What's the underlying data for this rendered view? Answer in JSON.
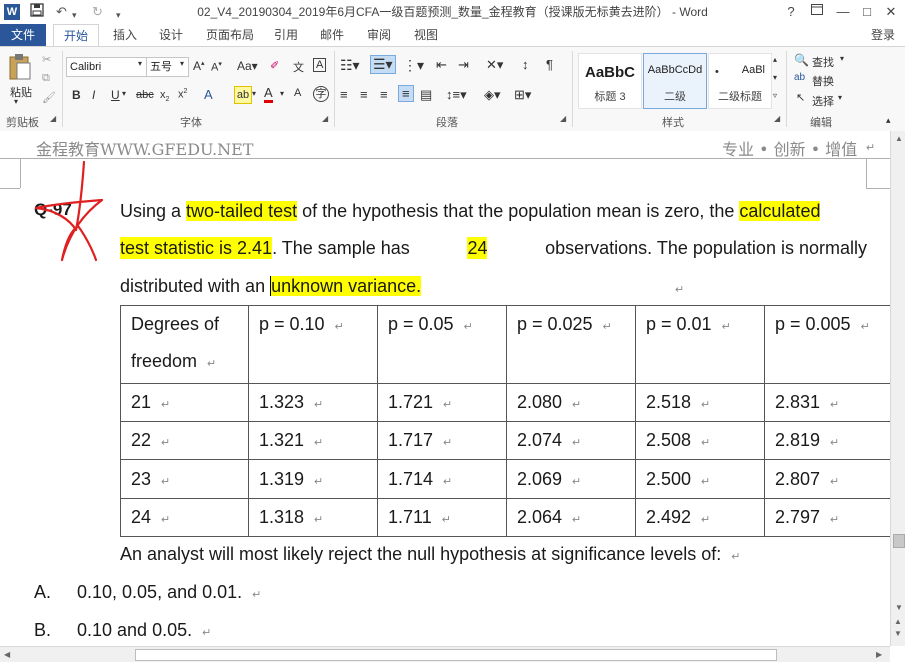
{
  "titlebar": {
    "app_icon": "W",
    "title": "02_V4_20190304_2019年6月CFA一级百题预测_数量_金程教育（授课版无标黄去进阶） - Word",
    "help": "?",
    "minimize": "—",
    "restore": "□",
    "close": "✕"
  },
  "tabs": {
    "file": "文件",
    "items": [
      "开始",
      "插入",
      "设计",
      "页面布局",
      "引用",
      "邮件",
      "审阅",
      "视图"
    ],
    "login": "登录"
  },
  "ribbon": {
    "clipboard": {
      "paste": "粘贴",
      "label": "剪贴板"
    },
    "font": {
      "name": "Calibri",
      "size": "五号",
      "label": "字体"
    },
    "paragraph": {
      "label": "段落"
    },
    "styles": {
      "label": "样式",
      "cards": [
        {
          "sample": "AaBbC",
          "name": "标题 3"
        },
        {
          "sample": "AaBbCcDd",
          "name": "二级"
        },
        {
          "sample": "AaBl",
          "name": "二级标题"
        }
      ]
    },
    "editing": {
      "find": "查找",
      "replace": "替换",
      "select": "选择",
      "label": "编辑"
    }
  },
  "document": {
    "header_left": "金程教育WWW.GFEDU.NET",
    "header_right": "专业 • 创新 • 增值",
    "question_no": "Q-97",
    "q_line1": {
      "a": "Using a ",
      "b": "two-tailed test",
      "c": " of the hypothesis that the population mean is zero, the ",
      "d": "calculated"
    },
    "q_line2": {
      "a": "test statistic is 2.41",
      "b": ". The sample has ",
      "c": "24",
      "d": " observations. The population is normally"
    },
    "q_line3": {
      "a": "distributed with an ",
      "b": "unknown variance."
    },
    "table": {
      "header_first_line1": "Degrees of",
      "header_first_line2": "freedom",
      "headers": [
        "p = 0.10",
        "p = 0.05",
        "p = 0.025",
        "p = 0.01",
        "p = 0.005"
      ],
      "rows": [
        [
          "21",
          "1.323",
          "1.721",
          "2.080",
          "2.518",
          "2.831"
        ],
        [
          "22",
          "1.321",
          "1.717",
          "2.074",
          "2.508",
          "2.819"
        ],
        [
          "23",
          "1.319",
          "1.714",
          "2.069",
          "2.500",
          "2.807"
        ],
        [
          "24",
          "1.318",
          "1.711",
          "2.064",
          "2.492",
          "2.797"
        ]
      ]
    },
    "analyst": "An analyst will most likely reject the null hypothesis at significance levels of:",
    "options": [
      {
        "letter": "A.",
        "text": "0.10, 0.05, and 0.01."
      },
      {
        "letter": "B.",
        "text": "0.10 and 0.05."
      }
    ]
  }
}
